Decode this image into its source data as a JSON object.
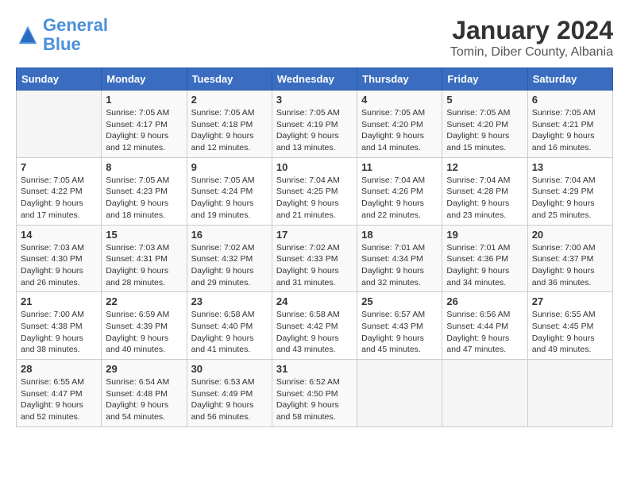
{
  "header": {
    "logo_line1": "General",
    "logo_line2": "Blue",
    "title": "January 2024",
    "subtitle": "Tomin, Diber County, Albania"
  },
  "weekdays": [
    "Sunday",
    "Monday",
    "Tuesday",
    "Wednesday",
    "Thursday",
    "Friday",
    "Saturday"
  ],
  "weeks": [
    [
      {
        "day": "",
        "sunrise": "",
        "sunset": "",
        "daylight": ""
      },
      {
        "day": "1",
        "sunrise": "Sunrise: 7:05 AM",
        "sunset": "Sunset: 4:17 PM",
        "daylight": "Daylight: 9 hours and 12 minutes."
      },
      {
        "day": "2",
        "sunrise": "Sunrise: 7:05 AM",
        "sunset": "Sunset: 4:18 PM",
        "daylight": "Daylight: 9 hours and 12 minutes."
      },
      {
        "day": "3",
        "sunrise": "Sunrise: 7:05 AM",
        "sunset": "Sunset: 4:19 PM",
        "daylight": "Daylight: 9 hours and 13 minutes."
      },
      {
        "day": "4",
        "sunrise": "Sunrise: 7:05 AM",
        "sunset": "Sunset: 4:20 PM",
        "daylight": "Daylight: 9 hours and 14 minutes."
      },
      {
        "day": "5",
        "sunrise": "Sunrise: 7:05 AM",
        "sunset": "Sunset: 4:20 PM",
        "daylight": "Daylight: 9 hours and 15 minutes."
      },
      {
        "day": "6",
        "sunrise": "Sunrise: 7:05 AM",
        "sunset": "Sunset: 4:21 PM",
        "daylight": "Daylight: 9 hours and 16 minutes."
      }
    ],
    [
      {
        "day": "7",
        "sunrise": "Sunrise: 7:05 AM",
        "sunset": "Sunset: 4:22 PM",
        "daylight": "Daylight: 9 hours and 17 minutes."
      },
      {
        "day": "8",
        "sunrise": "Sunrise: 7:05 AM",
        "sunset": "Sunset: 4:23 PM",
        "daylight": "Daylight: 9 hours and 18 minutes."
      },
      {
        "day": "9",
        "sunrise": "Sunrise: 7:05 AM",
        "sunset": "Sunset: 4:24 PM",
        "daylight": "Daylight: 9 hours and 19 minutes."
      },
      {
        "day": "10",
        "sunrise": "Sunrise: 7:04 AM",
        "sunset": "Sunset: 4:25 PM",
        "daylight": "Daylight: 9 hours and 21 minutes."
      },
      {
        "day": "11",
        "sunrise": "Sunrise: 7:04 AM",
        "sunset": "Sunset: 4:26 PM",
        "daylight": "Daylight: 9 hours and 22 minutes."
      },
      {
        "day": "12",
        "sunrise": "Sunrise: 7:04 AM",
        "sunset": "Sunset: 4:28 PM",
        "daylight": "Daylight: 9 hours and 23 minutes."
      },
      {
        "day": "13",
        "sunrise": "Sunrise: 7:04 AM",
        "sunset": "Sunset: 4:29 PM",
        "daylight": "Daylight: 9 hours and 25 minutes."
      }
    ],
    [
      {
        "day": "14",
        "sunrise": "Sunrise: 7:03 AM",
        "sunset": "Sunset: 4:30 PM",
        "daylight": "Daylight: 9 hours and 26 minutes."
      },
      {
        "day": "15",
        "sunrise": "Sunrise: 7:03 AM",
        "sunset": "Sunset: 4:31 PM",
        "daylight": "Daylight: 9 hours and 28 minutes."
      },
      {
        "day": "16",
        "sunrise": "Sunrise: 7:02 AM",
        "sunset": "Sunset: 4:32 PM",
        "daylight": "Daylight: 9 hours and 29 minutes."
      },
      {
        "day": "17",
        "sunrise": "Sunrise: 7:02 AM",
        "sunset": "Sunset: 4:33 PM",
        "daylight": "Daylight: 9 hours and 31 minutes."
      },
      {
        "day": "18",
        "sunrise": "Sunrise: 7:01 AM",
        "sunset": "Sunset: 4:34 PM",
        "daylight": "Daylight: 9 hours and 32 minutes."
      },
      {
        "day": "19",
        "sunrise": "Sunrise: 7:01 AM",
        "sunset": "Sunset: 4:36 PM",
        "daylight": "Daylight: 9 hours and 34 minutes."
      },
      {
        "day": "20",
        "sunrise": "Sunrise: 7:00 AM",
        "sunset": "Sunset: 4:37 PM",
        "daylight": "Daylight: 9 hours and 36 minutes."
      }
    ],
    [
      {
        "day": "21",
        "sunrise": "Sunrise: 7:00 AM",
        "sunset": "Sunset: 4:38 PM",
        "daylight": "Daylight: 9 hours and 38 minutes."
      },
      {
        "day": "22",
        "sunrise": "Sunrise: 6:59 AM",
        "sunset": "Sunset: 4:39 PM",
        "daylight": "Daylight: 9 hours and 40 minutes."
      },
      {
        "day": "23",
        "sunrise": "Sunrise: 6:58 AM",
        "sunset": "Sunset: 4:40 PM",
        "daylight": "Daylight: 9 hours and 41 minutes."
      },
      {
        "day": "24",
        "sunrise": "Sunrise: 6:58 AM",
        "sunset": "Sunset: 4:42 PM",
        "daylight": "Daylight: 9 hours and 43 minutes."
      },
      {
        "day": "25",
        "sunrise": "Sunrise: 6:57 AM",
        "sunset": "Sunset: 4:43 PM",
        "daylight": "Daylight: 9 hours and 45 minutes."
      },
      {
        "day": "26",
        "sunrise": "Sunrise: 6:56 AM",
        "sunset": "Sunset: 4:44 PM",
        "daylight": "Daylight: 9 hours and 47 minutes."
      },
      {
        "day": "27",
        "sunrise": "Sunrise: 6:55 AM",
        "sunset": "Sunset: 4:45 PM",
        "daylight": "Daylight: 9 hours and 49 minutes."
      }
    ],
    [
      {
        "day": "28",
        "sunrise": "Sunrise: 6:55 AM",
        "sunset": "Sunset: 4:47 PM",
        "daylight": "Daylight: 9 hours and 52 minutes."
      },
      {
        "day": "29",
        "sunrise": "Sunrise: 6:54 AM",
        "sunset": "Sunset: 4:48 PM",
        "daylight": "Daylight: 9 hours and 54 minutes."
      },
      {
        "day": "30",
        "sunrise": "Sunrise: 6:53 AM",
        "sunset": "Sunset: 4:49 PM",
        "daylight": "Daylight: 9 hours and 56 minutes."
      },
      {
        "day": "31",
        "sunrise": "Sunrise: 6:52 AM",
        "sunset": "Sunset: 4:50 PM",
        "daylight": "Daylight: 9 hours and 58 minutes."
      },
      {
        "day": "",
        "sunrise": "",
        "sunset": "",
        "daylight": ""
      },
      {
        "day": "",
        "sunrise": "",
        "sunset": "",
        "daylight": ""
      },
      {
        "day": "",
        "sunrise": "",
        "sunset": "",
        "daylight": ""
      }
    ]
  ]
}
